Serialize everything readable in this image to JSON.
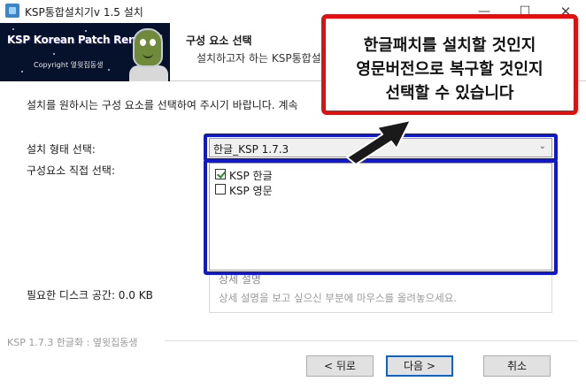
{
  "window": {
    "title": "KSP통합설치기v 1.5 설치",
    "min_glyph": "—",
    "max_glyph": "☐",
    "close_glyph": "✕"
  },
  "banner": {
    "title": "KSP Korean Patch Renewal",
    "copyright": "Copyright 옆윗집동생"
  },
  "header": {
    "heading": "구성 요소 선택",
    "subheading": "설치하고자 하는 KSP통합설"
  },
  "body": {
    "instruction": "설치를 원하시는 구성 요소를 선택하여 주시기 바랍니다. 계속",
    "install_type_label": "설치 형태 선택:",
    "install_type_value": "한글_KSP 1.7.3",
    "component_label": "구성요소 직접 선택:",
    "components": [
      {
        "label": "KSP 한글",
        "checked": true
      },
      {
        "label": "KSP 영문",
        "checked": false
      }
    ],
    "disk_label": "필요한 디스크 공간: 0.0 KB",
    "description_title": "상세 설명",
    "description_text": "상세 설명을 보고 싶으신 부분에 마우스를 올려놓으세요."
  },
  "footer": {
    "brand": "KSP 1.7.3 한글화 : 옆윗집동생",
    "back_label": "< 뒤로",
    "next_label": "다음 >",
    "cancel_label": "취소"
  },
  "annotation": {
    "lines": [
      "한글패치를 설치할 것인지",
      "영문버전으로 복구할 것인지",
      "선택할 수 있습니다"
    ],
    "box_color": "#e01010",
    "highlight_color": "#1018c8"
  },
  "icons": {
    "app": "installer-icon",
    "dropdown": "chevron-down-icon",
    "annotation_arrow": "arrow-icon"
  }
}
